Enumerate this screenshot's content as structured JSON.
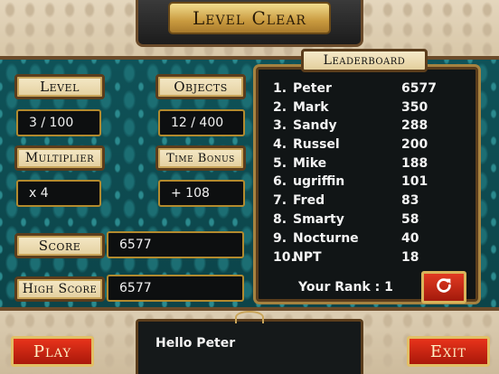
{
  "title": "Level Clear",
  "stats": {
    "level_label": "Level",
    "level_value": "3 / 100",
    "objects_label": "Objects",
    "objects_value": "12 / 400",
    "multiplier_label": "Multiplier",
    "multiplier_value": "x 4",
    "time_bonus_label": "Time Bonus",
    "time_bonus_value": "+ 108",
    "score_label": "Score",
    "score_value": "6577",
    "high_score_label": "High Score",
    "high_score_value": "6577"
  },
  "leaderboard": {
    "title": "Leaderboard",
    "entries": [
      {
        "rank": "1.",
        "name": "Peter",
        "score": "6577"
      },
      {
        "rank": "2.",
        "name": "Mark",
        "score": "350"
      },
      {
        "rank": "3.",
        "name": "Sandy",
        "score": "288"
      },
      {
        "rank": "4.",
        "name": "Russel",
        "score": "200"
      },
      {
        "rank": "5.",
        "name": "Mike",
        "score": "188"
      },
      {
        "rank": "6.",
        "name": "ugriffin",
        "score": "101"
      },
      {
        "rank": "7.",
        "name": "Fred",
        "score": "83"
      },
      {
        "rank": "8.",
        "name": "Smarty",
        "score": "58"
      },
      {
        "rank": "9.",
        "name": "Nocturne",
        "score": "40"
      },
      {
        "rank": "10.",
        "name": "NPT",
        "score": "18"
      }
    ],
    "your_rank": "Your Rank : 1",
    "refresh_icon": "refresh-icon"
  },
  "message": "Hello Peter",
  "buttons": {
    "play": "Play",
    "exit": "Exit"
  },
  "colors": {
    "teal": "#0f4a4f",
    "gold": "#c99a3f",
    "red": "#d12a15"
  }
}
